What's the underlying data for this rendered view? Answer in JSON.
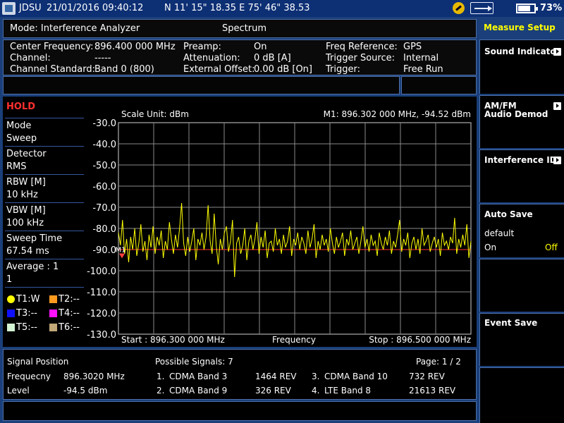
{
  "status": {
    "brand": "JDSU",
    "datetime": "21/01/2016 09:40:12",
    "gps_coords": "N 11' 15\" 18.35 E 75' 46\" 38.53",
    "battery": "73%",
    "icons": [
      "jdsu-logo-icon",
      "satellite-icon",
      "usb-icon",
      "battery-icon"
    ]
  },
  "mode": {
    "label": "Mode: Interference Analyzer",
    "view": "Spectrum"
  },
  "params": {
    "center_frequency_label": "Center Frequency:",
    "center_frequency_value": "896.400 000 MHz",
    "channel_label": "Channel:",
    "channel_value": "-----",
    "channel_standard_label": "Channel Standard:",
    "channel_standard_value": "Band 0 (800)",
    "preamp_label": "Preamp:",
    "preamp_value": "On",
    "attenuation_label": "Attenuation:",
    "attenuation_value": "0 dB  [A]",
    "external_offset_label": "External Offset:",
    "external_offset_value": "0.00 dB  [On]",
    "freq_reference_label": "Freq Reference:",
    "freq_reference_value": "GPS",
    "trigger_source_label": "Trigger Source:",
    "trigger_source_value": "Internal",
    "trigger_label": "Trigger:",
    "trigger_value": "Free Run"
  },
  "left": {
    "hold": "HOLD",
    "mode_label": "Mode",
    "mode_value": "Sweep",
    "detector_label": "Detector",
    "detector_value": "RMS",
    "rbw_label": "RBW [M]",
    "rbw_value": "10 kHz",
    "vbw_label": "VBW [M]",
    "vbw_value": "100 kHz",
    "sweep_time_label": "Sweep Time",
    "sweep_time_value": "67.54 ms",
    "average_label": "Average : 1",
    "average_value": "1",
    "traces": [
      {
        "label": "T1:W",
        "color": "#ffff00",
        "shape": "circle"
      },
      {
        "label": "T2:--",
        "color": "#ff9a1f",
        "shape": "square"
      },
      {
        "label": "T3:--",
        "color": "#1010ff",
        "shape": "square"
      },
      {
        "label": "T4:--",
        "color": "#ff10ff",
        "shape": "square"
      },
      {
        "label": "T5:--",
        "color": "#d4f4d4",
        "shape": "square"
      },
      {
        "label": "T6:--",
        "color": "#c2a878",
        "shape": "square"
      }
    ]
  },
  "chart_data": {
    "type": "line",
    "scale_unit": "Scale Unit: dBm",
    "marker_readout": "M1: 896.302 000 MHz, -94.52 dBm",
    "marker_label": "M1",
    "marker": {
      "x": 896.302,
      "y": -94.52
    },
    "y_ticks": [
      "-30.0",
      "-40.0",
      "-50.0",
      "-60.0",
      "-70.0",
      "-80.0",
      "-90.0",
      "-100.0",
      "-110.0",
      "-120.0",
      "-130.0"
    ],
    "ylim": [
      -130,
      -30
    ],
    "xlim": [
      896.3,
      896.5
    ],
    "x_start_label": "Start : 896.300 000 MHz",
    "x_center_label": "Frequency",
    "x_stop_label": "Stop : 896.500 000 MHz",
    "threshold_dbm": -90,
    "grid": true,
    "trace_color": "#ffff00",
    "threshold_color": "#ff3030",
    "series": [
      {
        "y": [
          -82,
          -88,
          -76,
          -92,
          -85,
          -96,
          -84,
          -90,
          -80,
          -93,
          -87,
          -78,
          -91,
          -86,
          -95,
          -83,
          -89,
          -79,
          -92,
          -84,
          -88,
          -81,
          -94,
          -86,
          -90,
          -77,
          -85,
          -92,
          -83,
          -89,
          -80,
          -68,
          -87,
          -93,
          -84,
          -91,
          -86,
          -80,
          -95,
          -85,
          -88,
          -82,
          -90,
          -84,
          -69,
          -86,
          -92,
          -73,
          -88,
          -97,
          -85,
          -90,
          -82,
          -79,
          -91,
          -86,
          -76,
          -103,
          -87,
          -84,
          -92,
          -88,
          -80,
          -95,
          -86,
          -83,
          -90,
          -85,
          -77,
          -92,
          -84,
          -89,
          -81,
          -94,
          -87,
          -86,
          -91,
          -80,
          -88,
          -85,
          -92,
          -83,
          -89,
          -86,
          -79,
          -93,
          -85,
          -88,
          -82,
          -90,
          -84,
          -87,
          -92,
          -81,
          -89,
          -85,
          -78,
          -94,
          -86,
          -90,
          -83,
          -88,
          -85,
          -91,
          -80,
          -87,
          -92,
          -84,
          -89,
          -86,
          -82,
          -93,
          -85,
          -88,
          -81,
          -90,
          -87,
          -84,
          -92,
          -86,
          -79,
          -89,
          -85,
          -91,
          -83,
          -88,
          -86,
          -93,
          -82,
          -87,
          -90,
          -84,
          -88,
          -81,
          -92,
          -86,
          -89,
          -83,
          -76,
          -91,
          -85,
          -88,
          -82,
          -94,
          -87,
          -84,
          -90,
          -85,
          -92,
          -80,
          -88,
          -86,
          -83,
          -91,
          -87,
          -84,
          -89,
          -85,
          -93,
          -82,
          -88,
          -86,
          -90,
          -84,
          -87,
          -75,
          -92,
          -85,
          -89,
          -83,
          -88,
          -78,
          -94,
          -86
        ]
      }
    ]
  },
  "bottom": {
    "signal_position_label": "Signal Position",
    "frequency_label": "Frequecny",
    "frequency_value": "896.3020 MHz",
    "level_label": "Level",
    "level_value": "-94.5 dBm",
    "possible_signals": "Possible Signals:  7",
    "page": "Page:  1 / 2",
    "signals": [
      {
        "idx": "1.",
        "name": "CDMA Band 3",
        "rev": "1464 REV"
      },
      {
        "idx": "2.",
        "name": "CDMA Band 9",
        "rev": "326 REV"
      },
      {
        "idx": "3.",
        "name": "CDMA Band 10",
        "rev": "732 REV"
      },
      {
        "idx": "4.",
        "name": "LTE Band 8",
        "rev": "21613 REV"
      }
    ]
  },
  "softkeys": {
    "header": "Measure Setup",
    "sound_indicator": "Sound Indicator",
    "am_fm_line1": "AM/FM",
    "am_fm_line2": "Audio Demod",
    "interference_id": "Interference ID",
    "auto_save": "Auto Save",
    "auto_save_default": "default",
    "auto_save_on": "On",
    "auto_save_off": "Off",
    "event_save": "Event Save"
  }
}
